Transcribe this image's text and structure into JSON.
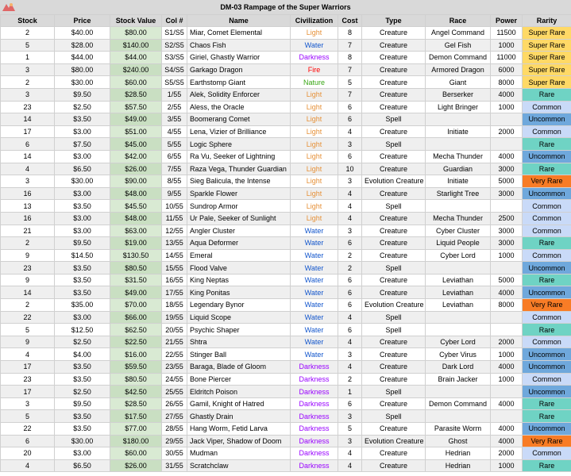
{
  "title": "DM-03 Rampage of the Super Warriors",
  "columns": [
    "Stock",
    "Price",
    "Stock Value",
    "Col #",
    "Name",
    "Civilization",
    "Cost",
    "Type",
    "Race",
    "Power",
    "Rarity"
  ],
  "civ_colors": {
    "Light": "#e69138",
    "Water": "#1155cc",
    "Darkness": "#9900ff",
    "Fire": "#ff0000",
    "Nature": "#38a614"
  },
  "rarity_colors": {
    "Super Rare": "#ffd966",
    "Very Rare": "#f87c26",
    "Rare": "#6fd3c4",
    "Uncommon": "#6fa8dc",
    "Common": "#c9daf8"
  },
  "rows": [
    [
      "2",
      "$40.00",
      "$80.00",
      "S1/S5",
      "Miar, Comet Elemental",
      "Light",
      "8",
      "Creature",
      "Angel Command",
      "11500",
      "Super Rare"
    ],
    [
      "5",
      "$28.00",
      "$140.00",
      "S2/S5",
      "Chaos Fish",
      "Water",
      "7",
      "Creature",
      "Gel Fish",
      "1000",
      "Super Rare"
    ],
    [
      "1",
      "$44.00",
      "$44.00",
      "S3/S5",
      "Giriel, Ghastly Warrior",
      "Darkness",
      "8",
      "Creature",
      "Demon Command",
      "11000",
      "Super Rare"
    ],
    [
      "3",
      "$80.00",
      "$240.00",
      "S4/S5",
      "Garkago Dragon",
      "Fire",
      "7",
      "Creature",
      "Armored Dragon",
      "6000",
      "Super Rare"
    ],
    [
      "2",
      "$30.00",
      "$60.00",
      "S5/S5",
      "Earthstomp Giant",
      "Nature",
      "5",
      "Creature",
      "Giant",
      "8000",
      "Super Rare"
    ],
    [
      "3",
      "$9.50",
      "$28.50",
      "1/55",
      "Alek, Solidity Enforcer",
      "Light",
      "7",
      "Creature",
      "Berserker",
      "4000",
      "Rare"
    ],
    [
      "23",
      "$2.50",
      "$57.50",
      "2/55",
      "Aless, the Oracle",
      "Light",
      "6",
      "Creature",
      "Light Bringer",
      "1000",
      "Common"
    ],
    [
      "14",
      "$3.50",
      "$49.00",
      "3/55",
      "Boomerang Comet",
      "Light",
      "6",
      "Spell",
      "",
      "",
      "Uncommon"
    ],
    [
      "17",
      "$3.00",
      "$51.00",
      "4/55",
      "Lena, Vizier of Brilliance",
      "Light",
      "4",
      "Creature",
      "Initiate",
      "2000",
      "Common"
    ],
    [
      "6",
      "$7.50",
      "$45.00",
      "5/55",
      "Logic Sphere",
      "Light",
      "3",
      "Spell",
      "",
      "",
      "Rare"
    ],
    [
      "14",
      "$3.00",
      "$42.00",
      "6/55",
      "Ra Vu, Seeker of Lightning",
      "Light",
      "6",
      "Creature",
      "Mecha Thunder",
      "4000",
      "Uncommon"
    ],
    [
      "4",
      "$6.50",
      "$26.00",
      "7/55",
      "Raza Vega, Thunder Guardian",
      "Light",
      "10",
      "Creature",
      "Guardian",
      "3000",
      "Rare"
    ],
    [
      "3",
      "$30.00",
      "$90.00",
      "8/55",
      "Sieg Balicula, the Intense",
      "Light",
      "3",
      "Evolution Creature",
      "Initiate",
      "5000",
      "Very Rare"
    ],
    [
      "16",
      "$3.00",
      "$48.00",
      "9/55",
      "Sparkle Flower",
      "Light",
      "4",
      "Creature",
      "Starlight Tree",
      "3000",
      "Uncommon"
    ],
    [
      "13",
      "$3.50",
      "$45.50",
      "10/55",
      "Sundrop Armor",
      "Light",
      "4",
      "Spell",
      "",
      "",
      "Common"
    ],
    [
      "16",
      "$3.00",
      "$48.00",
      "11/55",
      "Ur Pale, Seeker of Sunlight",
      "Light",
      "4",
      "Creature",
      "Mecha Thunder",
      "2500",
      "Common"
    ],
    [
      "21",
      "$3.00",
      "$63.00",
      "12/55",
      "Angler Cluster",
      "Water",
      "3",
      "Creature",
      "Cyber Cluster",
      "3000",
      "Common"
    ],
    [
      "2",
      "$9.50",
      "$19.00",
      "13/55",
      "Aqua Deformer",
      "Water",
      "6",
      "Creature",
      "Liquid People",
      "3000",
      "Rare"
    ],
    [
      "9",
      "$14.50",
      "$130.50",
      "14/55",
      "Emeral",
      "Water",
      "2",
      "Creature",
      "Cyber Lord",
      "1000",
      "Common"
    ],
    [
      "23",
      "$3.50",
      "$80.50",
      "15/55",
      "Flood Valve",
      "Water",
      "2",
      "Spell",
      "",
      "",
      "Uncommon"
    ],
    [
      "9",
      "$3.50",
      "$31.50",
      "16/55",
      "King Neptas",
      "Water",
      "6",
      "Creature",
      "Leviathan",
      "5000",
      "Rare"
    ],
    [
      "14",
      "$3.50",
      "$49.00",
      "17/55",
      "King Ponitas",
      "Water",
      "6",
      "Creature",
      "Leviathan",
      "4000",
      "Uncommon"
    ],
    [
      "2",
      "$35.00",
      "$70.00",
      "18/55",
      "Legendary Bynor",
      "Water",
      "6",
      "Evolution Creature",
      "Leviathan",
      "8000",
      "Very Rare"
    ],
    [
      "22",
      "$3.00",
      "$66.00",
      "19/55",
      "Liquid Scope",
      "Water",
      "4",
      "Spell",
      "",
      "",
      "Common"
    ],
    [
      "5",
      "$12.50",
      "$62.50",
      "20/55",
      "Psychic Shaper",
      "Water",
      "6",
      "Spell",
      "",
      "",
      "Rare"
    ],
    [
      "9",
      "$2.50",
      "$22.50",
      "21/55",
      "Shtra",
      "Water",
      "4",
      "Creature",
      "Cyber Lord",
      "2000",
      "Common"
    ],
    [
      "4",
      "$4.00",
      "$16.00",
      "22/55",
      "Stinger Ball",
      "Water",
      "3",
      "Creature",
      "Cyber Virus",
      "1000",
      "Uncommon"
    ],
    [
      "17",
      "$3.50",
      "$59.50",
      "23/55",
      "Baraga, Blade of Gloom",
      "Darkness",
      "4",
      "Creature",
      "Dark Lord",
      "4000",
      "Uncommon"
    ],
    [
      "23",
      "$3.50",
      "$80.50",
      "24/55",
      "Bone Piercer",
      "Darkness",
      "2",
      "Creature",
      "Brain Jacker",
      "1000",
      "Common"
    ],
    [
      "17",
      "$2.50",
      "$42.50",
      "25/55",
      "Eldritch Poison",
      "Darkness",
      "1",
      "Spell",
      "",
      "",
      "Uncommon"
    ],
    [
      "3",
      "$9.50",
      "$28.50",
      "26/55",
      "Gamil, Knight of Hatred",
      "Darkness",
      "6",
      "Creature",
      "Demon Command",
      "4000",
      "Rare"
    ],
    [
      "5",
      "$3.50",
      "$17.50",
      "27/55",
      "Ghastly Drain",
      "Darkness",
      "3",
      "Spell",
      "",
      "",
      "Rare"
    ],
    [
      "22",
      "$3.50",
      "$77.00",
      "28/55",
      "Hang Worm, Fetid Larva",
      "Darkness",
      "5",
      "Creature",
      "Parasite Worm",
      "4000",
      "Uncommon"
    ],
    [
      "6",
      "$30.00",
      "$180.00",
      "29/55",
      "Jack Viper, Shadow of Doom",
      "Darkness",
      "3",
      "Evolution Creature",
      "Ghost",
      "4000",
      "Very Rare"
    ],
    [
      "20",
      "$3.00",
      "$60.00",
      "30/55",
      "Mudman",
      "Darkness",
      "4",
      "Creature",
      "Hedrian",
      "2000",
      "Common"
    ],
    [
      "4",
      "$6.50",
      "$26.00",
      "31/55",
      "Scratchclaw",
      "Darkness",
      "4",
      "Creature",
      "Hedrian",
      "1000",
      "Rare"
    ]
  ]
}
